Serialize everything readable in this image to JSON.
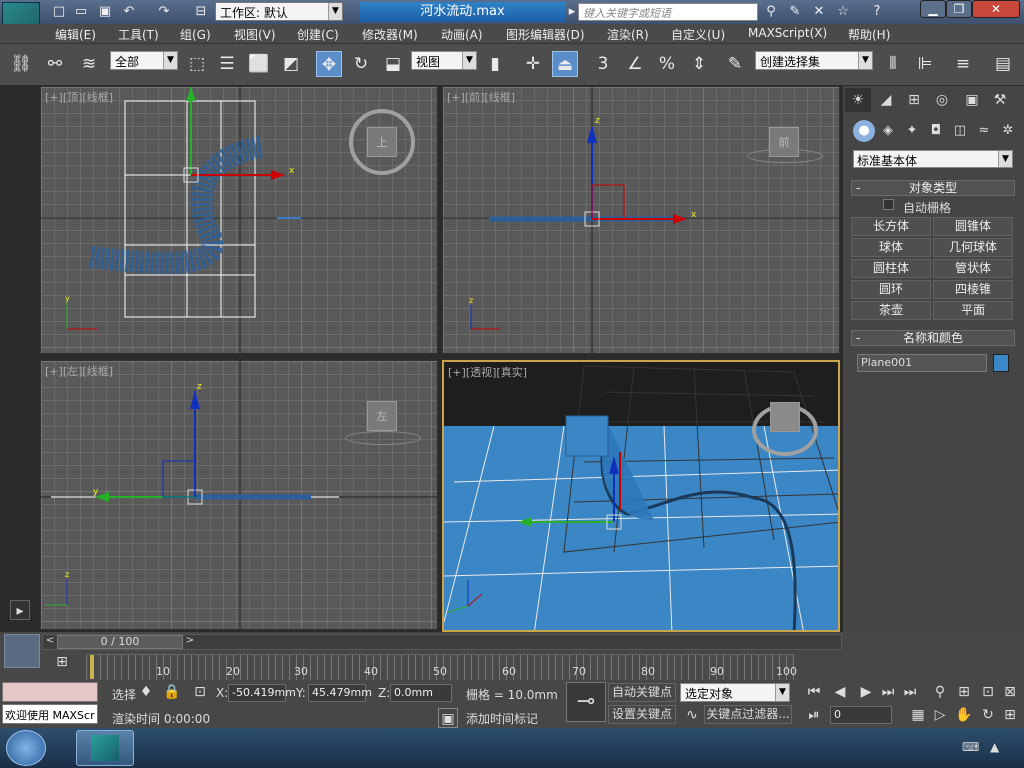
{
  "window": {
    "workspace_label": "工作区: 默认",
    "doc_title": "河水流动.max",
    "search_placeholder": "键入关键字或短语"
  },
  "menu": [
    "编辑(E)",
    "工具(T)",
    "组(G)",
    "视图(V)",
    "创建(C)",
    "修改器(M)",
    "动画(A)",
    "图形编辑器(D)",
    "渲染(R)",
    "自定义(U)",
    "MAXScript(X)",
    "帮助(H)"
  ],
  "toolbar": {
    "selection_filter": "全部",
    "reference_coord": "视图",
    "snap_num": "3",
    "named_selection": "创建选择集"
  },
  "viewports": {
    "top": {
      "l1": "[+]",
      "l2": "[顶]",
      "l3": "[线框]",
      "cube": "上"
    },
    "front": {
      "l1": "[+]",
      "l2": "[前]",
      "l3": "[线框]",
      "cube": "前"
    },
    "left": {
      "l1": "[+]",
      "l2": "[左]",
      "l3": "[线框]",
      "cube": "左"
    },
    "persp": {
      "l1": "[+]",
      "l2": "[透视]",
      "l3": "[真实]"
    }
  },
  "command_panel": {
    "category": "标准基本体",
    "object_type_title": "对象类型",
    "autogrid": "自动栅格",
    "buttons": [
      "长方体",
      "圆锥体",
      "球体",
      "几何球体",
      "圆柱体",
      "管状体",
      "圆环",
      "四棱锥",
      "茶壶",
      "平面"
    ],
    "name_color_title": "名称和颜色",
    "object_name": "Plane001",
    "object_color": "#3a88c8"
  },
  "timeline": {
    "slider": "0 / 100",
    "ticks": [
      "10",
      "20",
      "30",
      "40",
      "50",
      "60",
      "70",
      "80",
      "90",
      "100"
    ]
  },
  "status": {
    "welcome": "欢迎使用 MAXScr",
    "select_label": "选择",
    "x_label": "X:",
    "x": "-50.419mm",
    "y_label": "Y:",
    "y": "45.479mm",
    "z_label": "Z:",
    "z": "0.0mm",
    "grid": "栅格 = 10.0mm",
    "render_time": "渲染时间  0:00:00",
    "add_time_tag": "添加时间标记",
    "auto_key": "自动关键点",
    "set_key": "设置关键点",
    "key_mode": "选定对象",
    "key_filter": "关键点过滤器...",
    "frame": "0"
  }
}
